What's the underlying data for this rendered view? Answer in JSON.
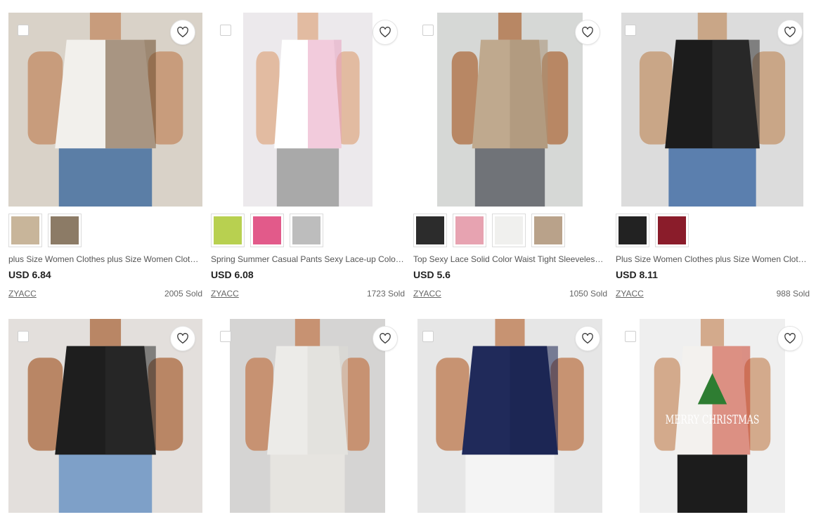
{
  "products": [
    {
      "title": "plus Size Women Clothes plus Size Women Clothes Long Sleeve Off Shoulder Leopard Top",
      "price": "USD 6.84",
      "seller": "ZYACC",
      "sold": "2005 Sold",
      "swatches": [
        "#c8b59a",
        "#8c7b66"
      ],
      "colors": {
        "bg": "#d9d2c8",
        "garment": "#f2f0ec",
        "accent": "#6b4a2c",
        "skin": "#c89c7c",
        "pants": "#5b7ea6"
      }
    },
    {
      "title": "Spring Summer Casual Pants Sexy Lace-up Color Block Leggings Women",
      "price": "USD 6.08",
      "seller": "ZYACC",
      "sold": "1723 Sold",
      "swatches": [
        "#b8d050",
        "#e25a8a",
        "#bdbdbd"
      ],
      "colors": {
        "bg": "#ece9ec",
        "garment": "#ffffff",
        "accent": "#e7a0c0",
        "skin": "#e2bba1",
        "pants": "#a9a9a9"
      }
    },
    {
      "title": "Top Sexy Lace Solid Color Waist Tight Sleeveless Tank Top Women",
      "price": "USD 5.6",
      "seller": "ZYACC",
      "sold": "1050 Sold",
      "swatches": [
        "#2c2c2c",
        "#e7a3b1",
        "#f0f0ee",
        "#b9a28a"
      ],
      "colors": {
        "bg": "#d6d8d6",
        "garment": "#bfa98e",
        "accent": "#a88f74",
        "skin": "#b88764",
        "pants": "#707378"
      }
    },
    {
      "title": "Plus Size Women Clothes plus Size Women Clothes Long Sleeve Lace Back Shirt",
      "price": "USD 8.11",
      "seller": "ZYACC",
      "sold": "988 Sold",
      "swatches": [
        "#222222",
        "#8a1c2a"
      ],
      "colors": {
        "bg": "#dcdcdc",
        "garment": "#1c1c1c",
        "accent": "#333333",
        "skin": "#c9a687",
        "pants": "#5b7fae"
      }
    },
    {
      "title": "",
      "price": "",
      "seller": "",
      "sold": "",
      "swatches": [],
      "colors": {
        "bg": "#e3dfdc",
        "garment": "#1e1e1e",
        "accent": "#2d2d2d",
        "skin": "#b98665",
        "pants": "#7ea0c8"
      }
    },
    {
      "title": "",
      "price": "",
      "seller": "",
      "sold": "",
      "swatches": [],
      "colors": {
        "bg": "#d5d4d3",
        "garment": "#ecebe8",
        "accent": "#dcdad6",
        "skin": "#c79272",
        "pants": "#e6e4e0"
      }
    },
    {
      "title": "",
      "price": "",
      "seller": "",
      "sold": "",
      "swatches": [],
      "colors": {
        "bg": "#e6e6e6",
        "garment": "#202a5a",
        "accent": "#1a2350",
        "skin": "#c79372",
        "pants": "#f4f4f4"
      }
    },
    {
      "title": "",
      "price": "",
      "seller": "",
      "sold": "",
      "swatches": [],
      "colors": {
        "bg": "#efefef",
        "garment": "#f3f1ee",
        "accent": "#c8402c",
        "skin": "#d3aa8c",
        "pants": "#1c1c1c"
      },
      "print_text": "MERRY CHRISTMAS"
    }
  ],
  "icons": {
    "favorite": "heart-outline-icon",
    "select": "checkbox-icon"
  }
}
